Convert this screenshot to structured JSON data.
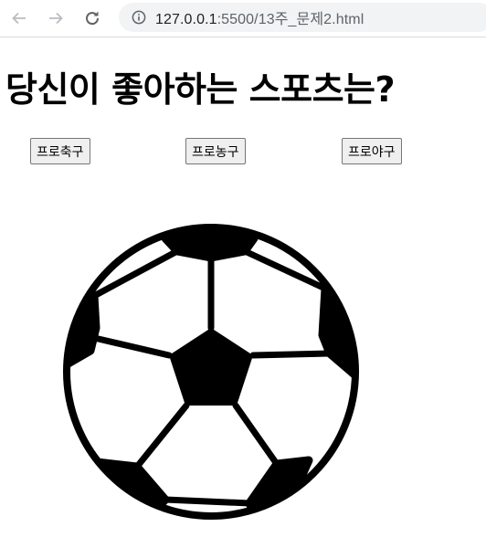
{
  "browser": {
    "url_host": "127.0.0.1",
    "url_path": ":5500/13주_문제2.html",
    "back_icon": "arrow-left-icon",
    "forward_icon": "arrow-right-icon",
    "reload_icon": "reload-icon",
    "info_icon": "info-icon"
  },
  "page": {
    "title": "당신이 좋아하는 스포츠는?",
    "buttons": [
      {
        "label": "프로축구"
      },
      {
        "label": "프로농구"
      },
      {
        "label": "프로야구"
      }
    ],
    "image": {
      "icon": "soccer-ball-icon"
    }
  }
}
